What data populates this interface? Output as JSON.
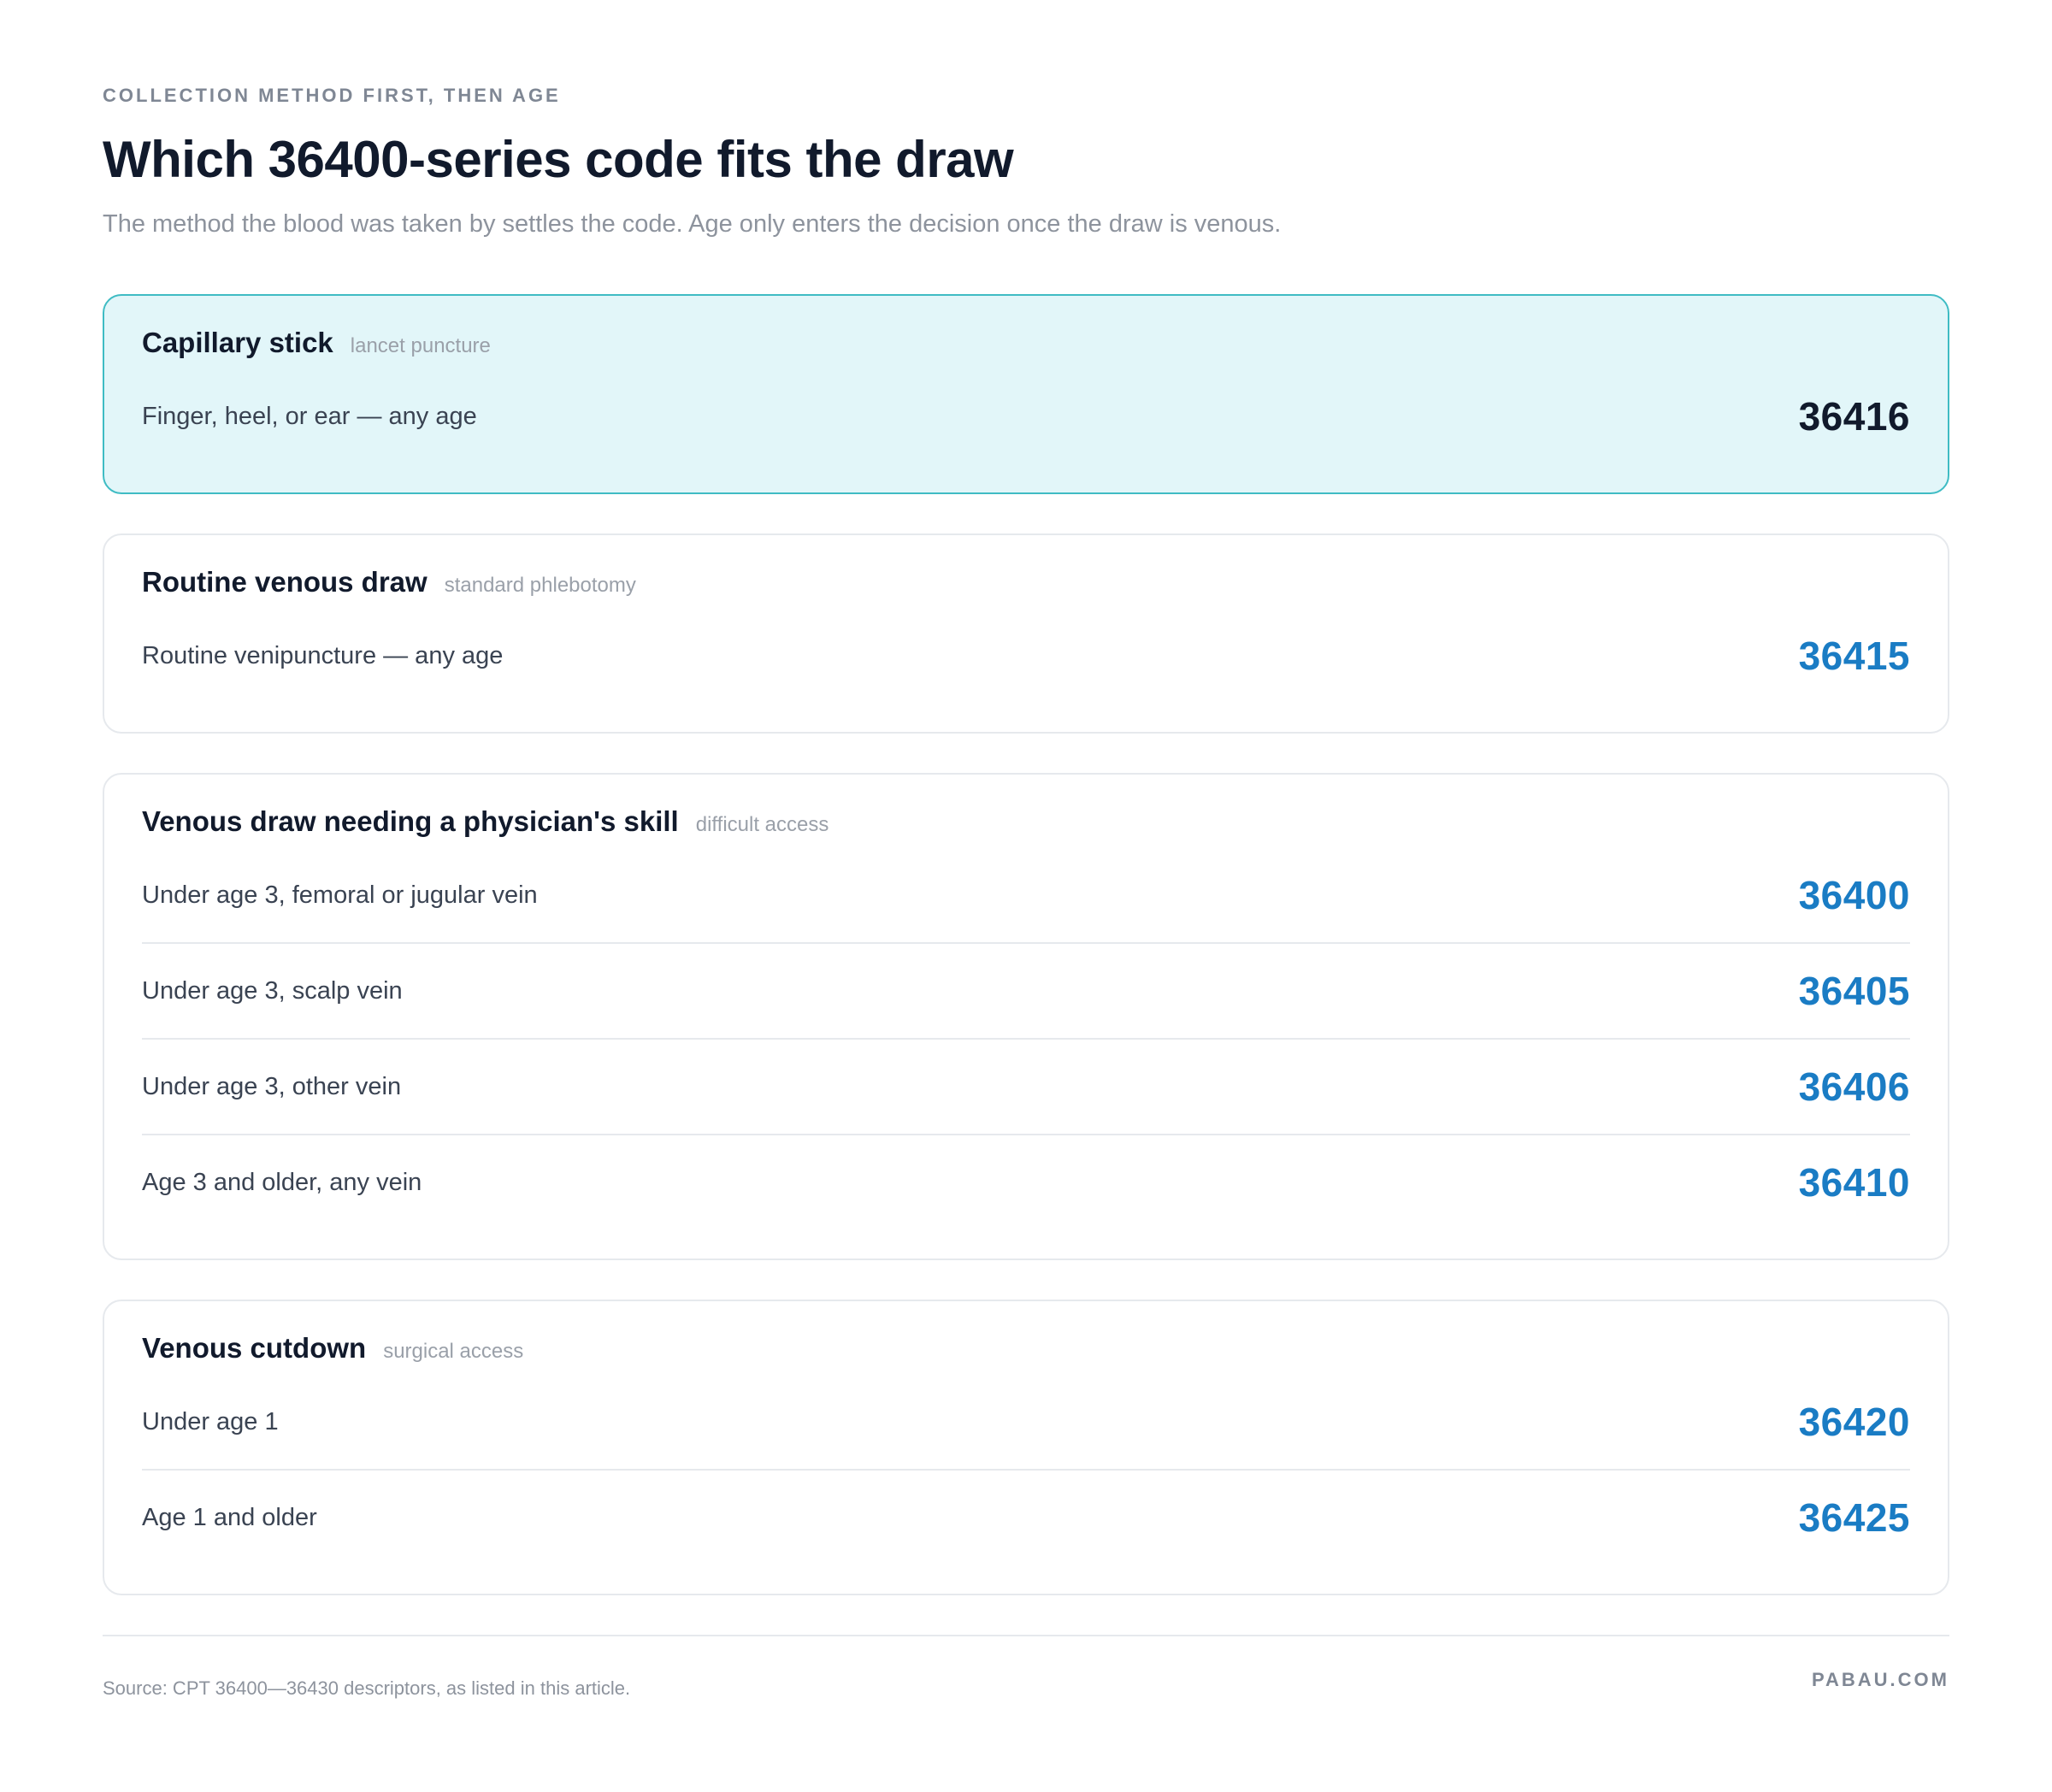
{
  "header": {
    "eyebrow": "COLLECTION METHOD FIRST, THEN AGE",
    "title": "Which 36400-series code fits the draw",
    "subtitle": "The method the blood was taken by settles the code. Age only enters the decision once the draw is venous."
  },
  "cards": [
    {
      "title": "Capillary stick",
      "tag": "lancet puncture",
      "highlighted": true,
      "rows": [
        {
          "label": "Finger, heel, or ear — any age",
          "code": "36416"
        }
      ]
    },
    {
      "title": "Routine venous draw",
      "tag": "standard phlebotomy",
      "highlighted": false,
      "rows": [
        {
          "label": "Routine venipuncture — any age",
          "code": "36415"
        }
      ]
    },
    {
      "title": "Venous draw needing a physician's skill",
      "tag": "difficult access",
      "highlighted": false,
      "rows": [
        {
          "label": "Under age 3, femoral or jugular vein",
          "code": "36400"
        },
        {
          "label": "Under age 3, scalp vein",
          "code": "36405"
        },
        {
          "label": "Under age 3, other vein",
          "code": "36406"
        },
        {
          "label": "Age 3 and older, any vein",
          "code": "36410"
        }
      ]
    },
    {
      "title": "Venous cutdown",
      "tag": "surgical access",
      "highlighted": false,
      "rows": [
        {
          "label": "Under age 1",
          "code": "36420"
        },
        {
          "label": "Age 1 and older",
          "code": "36425"
        }
      ]
    }
  ],
  "footer": {
    "source": "Source: CPT 36400—36430 descriptors, as listed in this article.",
    "brand": "PABAU.COM"
  },
  "colors": {
    "highlight_bg": "#e2f6f9",
    "highlight_border": "#3fbcc4",
    "code_blue": "#1a7cc4",
    "heading": "#111a2c"
  }
}
